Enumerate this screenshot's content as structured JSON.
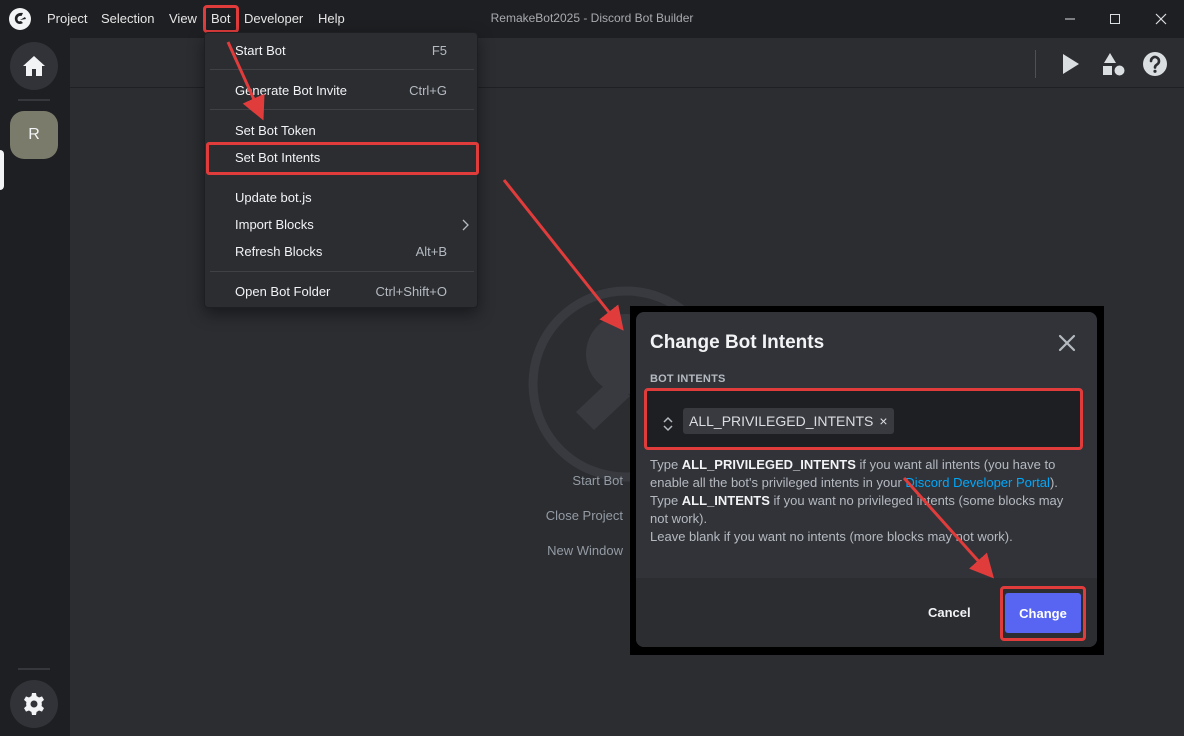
{
  "window": {
    "title": "RemakeBot2025 - Discord Bot Builder",
    "menu": [
      "Project",
      "Selection",
      "View",
      "Bot",
      "Developer",
      "Help"
    ]
  },
  "rail": {
    "server_initial": "R"
  },
  "start_links": [
    "Start Bot",
    "Close Project",
    "New Window"
  ],
  "bot_menu": {
    "items": [
      {
        "label": "Start Bot",
        "shortcut": "F5"
      },
      {
        "label": "Generate Bot Invite",
        "shortcut": "Ctrl+G"
      },
      {
        "label": "Set Bot Token",
        "shortcut": ""
      },
      {
        "label": "Set Bot Intents",
        "shortcut": ""
      },
      {
        "label": "Update bot.js",
        "shortcut": ""
      },
      {
        "label": "Import Blocks",
        "shortcut": ""
      },
      {
        "label": "Refresh Blocks",
        "shortcut": "Alt+B"
      },
      {
        "label": "Open Bot Folder",
        "shortcut": "Ctrl+Shift+O"
      }
    ]
  },
  "dialog": {
    "title": "Change Bot Intents",
    "field_label": "BOT INTENTS",
    "selected_intent": "ALL_PRIVILEGED_INTENTS",
    "remove_glyph": "×",
    "help": {
      "line1_pre": "Type ",
      "line1_bold": "ALL_PRIVILEGED_INTENTS",
      "line1_post": " if you want all intents (you have to enable all the bot's privileged intents in your ",
      "line1_link": "Discord Developer Portal",
      "line1_end": ").",
      "line2_pre": "Type ",
      "line2_bold": "ALL_INTENTS",
      "line2_post": " if you want no privileged intents (some blocks may not work).",
      "line3": "Leave blank if you want no intents (more blocks may not work)."
    },
    "cancel_label": "Cancel",
    "change_label": "Change"
  },
  "colors": {
    "annotation_red": "#e03c3c",
    "accent_blurple": "#5865f2",
    "link_blue": "#00a8fc"
  },
  "icons": [
    "app-logo",
    "minimize-icon",
    "maximize-icon",
    "close-icon",
    "home-icon",
    "settings-gear-icon",
    "play-icon",
    "shapes-icon",
    "help-icon",
    "chevron-right-icon",
    "sort-icon",
    "dialog-close-icon"
  ]
}
